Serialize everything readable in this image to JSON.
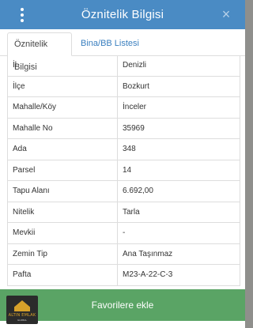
{
  "header": {
    "title": "Öznitelik Bilgisi",
    "close_icon": "×",
    "menu_icon": "vertical-dots"
  },
  "tabs": [
    {
      "label": "Öznitelik Bilgisi",
      "active": true
    },
    {
      "label": "Bina/BB Listesi",
      "active": false
    }
  ],
  "attributes": [
    {
      "key": "İl",
      "value": "Denizli"
    },
    {
      "key": "İlçe",
      "value": "Bozkurt"
    },
    {
      "key": "Mahalle/Köy",
      "value": "İnceler"
    },
    {
      "key": "Mahalle No",
      "value": "35969"
    },
    {
      "key": "Ada",
      "value": "348"
    },
    {
      "key": "Parsel",
      "value": "14"
    },
    {
      "key": "Tapu Alanı",
      "value": "6.692,00"
    },
    {
      "key": "Nitelik",
      "value": "Tarla"
    },
    {
      "key": "Mevkii",
      "value": "-"
    },
    {
      "key": "Zemin Tip",
      "value": "Ana Taşınmaz"
    },
    {
      "key": "Pafta",
      "value": "M23-A-22-C-3"
    }
  ],
  "actions": {
    "favorite_label": "Favorilere ekle"
  },
  "logo": {
    "name": "ALTIN EMLAK",
    "sub": "GLOBAL"
  },
  "colors": {
    "header": "#4a8bc4",
    "button": "#5aa465",
    "tab_link": "#3a7fbf"
  }
}
